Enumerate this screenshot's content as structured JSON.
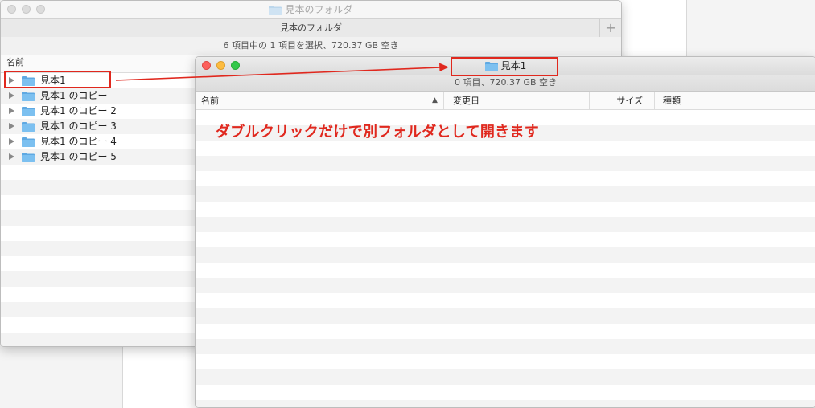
{
  "back_window": {
    "title": "見本のフォルダ",
    "tab_label": "見本のフォルダ",
    "tab_add": "+",
    "status": "6 項目中の 1 項目を選択、720.37 GB 空き",
    "column_name": "名前",
    "items": [
      {
        "label": "見本1"
      },
      {
        "label": "見本1 のコピー"
      },
      {
        "label": "見本1 のコピー 2"
      },
      {
        "label": "見本1 のコピー 3"
      },
      {
        "label": "見本1 のコピー 4"
      },
      {
        "label": "見本1 のコピー 5"
      }
    ]
  },
  "front_window": {
    "title": "見本1",
    "status": "0 項目、720.37 GB 空き",
    "columns": {
      "name": "名前",
      "modified": "変更日",
      "size": "サイズ",
      "kind": "種類"
    }
  },
  "annotation": {
    "text": "ダブルクリックだけで別フォルダとして開きます",
    "color": "#e0281e"
  },
  "icons": {
    "folder": "folder-icon",
    "disclosure": "disclosure-triangle-icon",
    "sort": "sort-ascending-icon"
  },
  "colors": {
    "folder": "#7cc0f0",
    "folder_tab": "#5fa9e2"
  }
}
